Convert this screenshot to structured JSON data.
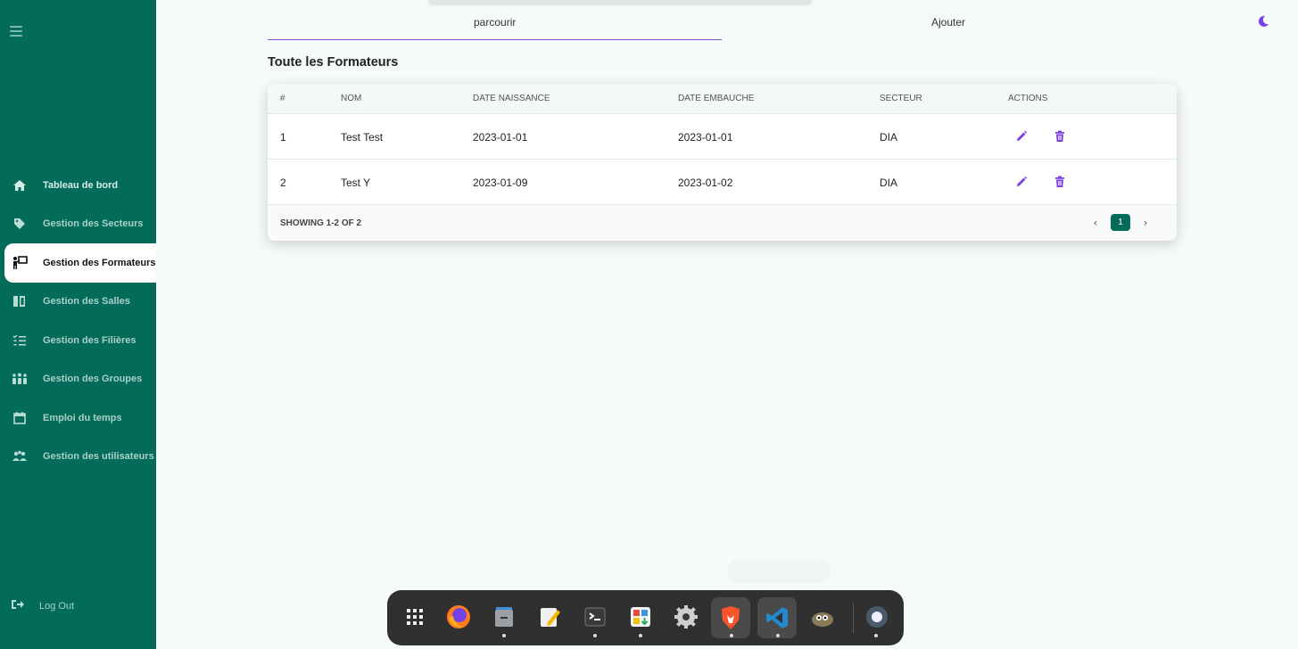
{
  "sidebar": {
    "items": [
      {
        "label": "Tableau de bord",
        "icon": "home-icon"
      },
      {
        "label": "Gestion des Secteurs",
        "icon": "tag-icon"
      },
      {
        "label": "Gestion des Formateurs",
        "icon": "teacher-icon",
        "active": true
      },
      {
        "label": "Gestion des Salles",
        "icon": "door-icon"
      },
      {
        "label": "Gestion des Filières",
        "icon": "checklist-icon"
      },
      {
        "label": "Gestion des Groupes",
        "icon": "group-icon"
      },
      {
        "label": "Emploi du temps",
        "icon": "calendar-icon"
      },
      {
        "label": "Gestion des utilisateurs",
        "icon": "users-icon"
      }
    ],
    "logout_label": "Log Out"
  },
  "tabs": {
    "browse": "parcourir",
    "add": "Ajouter"
  },
  "page": {
    "title": "Toute les Formateurs"
  },
  "table": {
    "headers": [
      "#",
      "NOM",
      "DATE NAISSANCE",
      "DATE EMBAUCHE",
      "SECTEUR",
      "ACTIONS"
    ],
    "rows": [
      {
        "id": "1",
        "nom": "Test Test",
        "date_naissance": "2023-01-01",
        "date_embauche": "2023-01-01",
        "secteur": "DIA"
      },
      {
        "id": "2",
        "nom": "Test Y",
        "date_naissance": "2023-01-09",
        "date_embauche": "2023-01-02",
        "secteur": "DIA"
      }
    ],
    "showing": "SHOWING 1-2 OF 2",
    "current_page": "1",
    "prev": "‹",
    "next": "›"
  },
  "colors": {
    "sidebar": "#036b59",
    "accent": "#7b3fe4",
    "background": "#f5fafa"
  },
  "dock": {
    "apps": [
      "app-grid-icon",
      "firefox-icon",
      "files-icon",
      "text-editor-icon",
      "terminal-icon",
      "software-icon",
      "settings-icon",
      "brave-icon",
      "vscode-icon",
      "gimp-icon",
      "obs-icon"
    ]
  }
}
